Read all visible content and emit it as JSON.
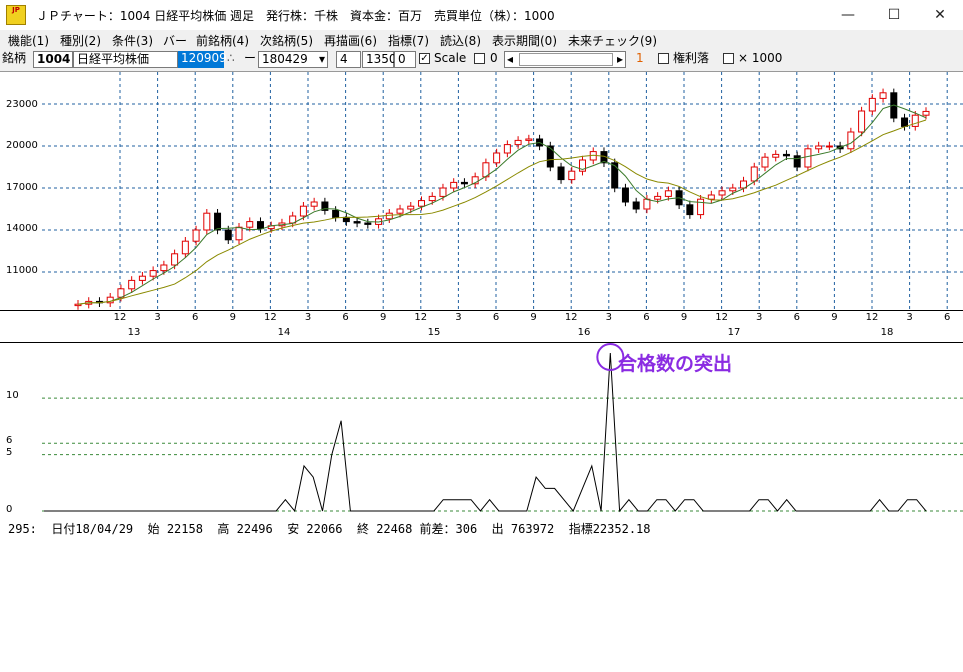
{
  "window": {
    "title": "ＪＰチャート：1004 日経平均株価 週足　発行株：千株　資本金：百万　売買単位（株）：1000",
    "icon_text": "JP",
    "minimize": "—",
    "maximize": "☐",
    "close": "✕"
  },
  "menu": [
    {
      "label": "機能(1)"
    },
    {
      "label": "種別(2)"
    },
    {
      "label": "条件(3)"
    },
    {
      "label": "バー"
    },
    {
      "label": "前銘柄(4)"
    },
    {
      "label": "次銘柄(5)"
    },
    {
      "label": "再描画(6)"
    },
    {
      "label": "指標(7)"
    },
    {
      "label": "読込(8)"
    },
    {
      "label": "表示期間(0)"
    },
    {
      "label": "未来チェック(9)"
    }
  ],
  "toolbar": {
    "code_label": "銘柄",
    "code_value": "1004",
    "name_value": "日経平均株価",
    "start_date": "120909",
    "dash": "ー",
    "end_date": "180429",
    "num1": "4",
    "num2": "1350",
    "num3": "0",
    "scale_label": "Scale",
    "zero_label": "0",
    "marker": "1",
    "kenri_label": "権利落",
    "x1000_label": "× 1000"
  },
  "upper_yaxis": [
    "23000",
    "20000",
    "17000",
    "14000",
    "11000"
  ],
  "xaxis_months": [
    "12",
    "3",
    "6",
    "9",
    "12",
    "3",
    "6",
    "9",
    "12",
    "3",
    "6",
    "9",
    "12",
    "3",
    "6",
    "9",
    "12",
    "3",
    "6",
    "9",
    "12",
    "3",
    "6"
  ],
  "xaxis_years": [
    "13",
    "14",
    "15",
    "16",
    "17",
    "18"
  ],
  "lower_yaxis": [
    "10",
    "6",
    "5",
    "0"
  ],
  "status_line": "295:  日付18/04/29  始 22158  高 22496  安 22066  終 22468 前差：306  出 763972  指標22352.18",
  "annotation": "合格数の突出",
  "colors": {
    "up": "#e00000",
    "down": "#000000",
    "ma_short": "#3a7a2a",
    "ma_long": "#8a8a00",
    "grid": "#2060a0",
    "annotation": "#8a2be2"
  },
  "chart_data": [
    {
      "type": "candlestick",
      "title": "",
      "ylim": [
        8000,
        25500
      ],
      "yticks": [
        11000,
        14000,
        17000,
        20000,
        23000
      ],
      "series": [
        {
          "name": "close",
          "values": [
            8700,
            8900,
            8800,
            9200,
            9800,
            10400,
            10700,
            11100,
            11500,
            12300,
            13200,
            14000,
            15200,
            14000,
            13300,
            14200,
            14600,
            14100,
            14300,
            14500,
            15000,
            15700,
            16000,
            15400,
            14900,
            14600,
            14500,
            14400,
            14800,
            15200,
            15500,
            15700,
            16100,
            16400,
            17000,
            17400,
            17300,
            17800,
            18800,
            19500,
            20100,
            20400,
            20500,
            20000,
            18500,
            17600,
            18200,
            19000,
            19600,
            18800,
            17000,
            16000,
            15500,
            16200,
            16400,
            16800,
            15800,
            15100,
            16200,
            16500,
            16800,
            17000,
            17500,
            18500,
            19200,
            19400,
            19300,
            18500,
            19800,
            20000,
            20000,
            19800,
            21000,
            22500,
            23400,
            23800,
            22000,
            21400,
            22200,
            22470
          ]
        }
      ]
    },
    {
      "type": "line",
      "title": "",
      "ylim": [
        0,
        14
      ],
      "yticks": [
        0,
        5,
        6,
        10
      ],
      "annotation": "合格数の突出",
      "series": [
        {
          "name": "",
          "values": [
            0,
            0,
            0,
            0,
            0,
            0,
            0,
            0,
            0,
            0,
            0,
            0,
            0,
            0,
            0,
            0,
            0,
            0,
            0,
            0,
            0,
            0,
            0,
            0,
            0,
            0,
            1,
            0,
            4,
            3,
            0,
            5,
            8,
            0,
            0,
            0,
            0,
            0,
            0,
            0,
            0,
            0,
            0,
            1,
            1,
            1,
            1,
            0,
            1,
            0,
            0,
            0,
            0,
            3,
            2,
            2,
            1,
            0,
            2,
            4,
            0,
            14,
            0,
            1,
            0,
            0,
            1,
            1,
            0,
            1,
            1,
            0,
            0,
            0,
            0,
            0,
            0,
            1,
            1,
            0,
            1,
            0,
            0,
            0,
            0,
            0,
            0,
            0,
            0,
            0,
            1,
            0,
            0,
            1,
            1,
            0
          ]
        }
      ]
    }
  ]
}
